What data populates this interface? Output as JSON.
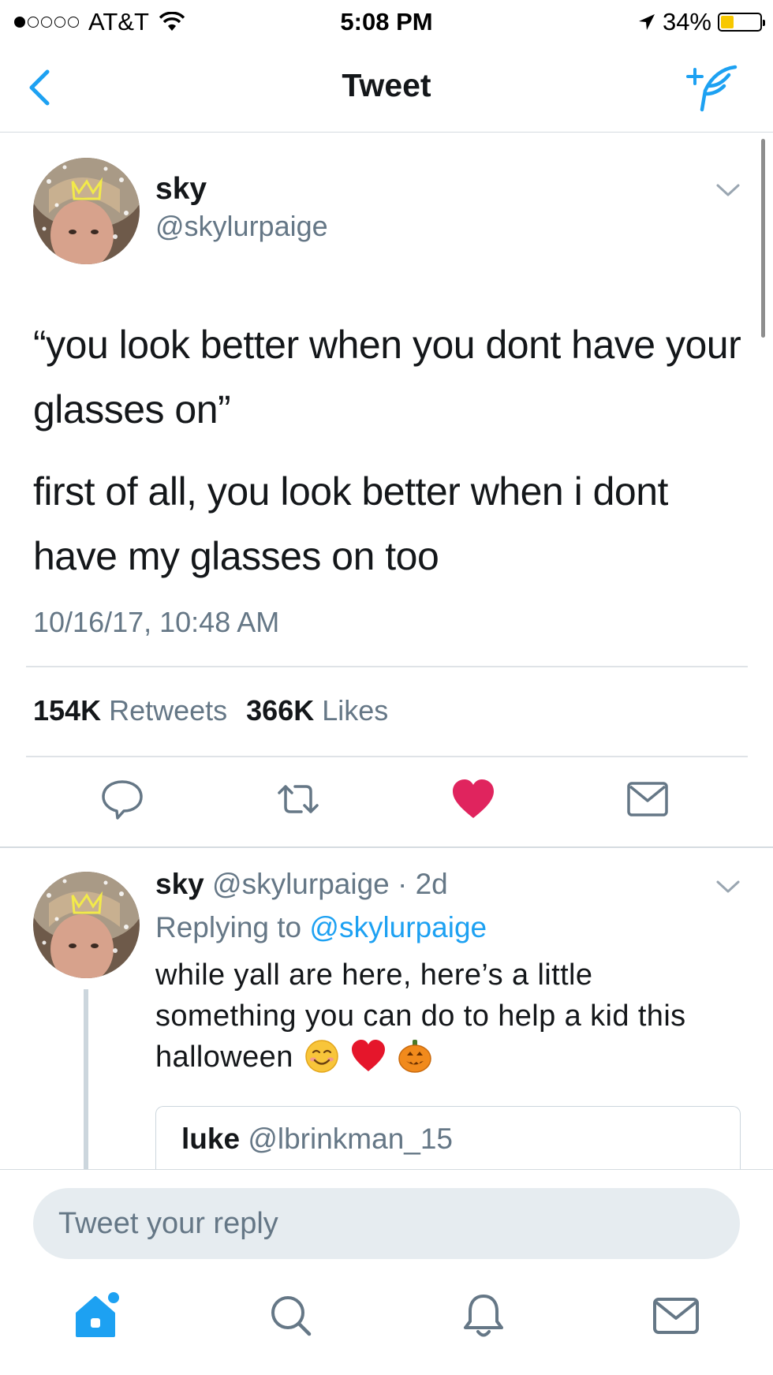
{
  "status_bar": {
    "carrier": "AT&T",
    "time": "5:08 PM",
    "battery": "34%",
    "battery_level": 0.34
  },
  "header": {
    "title": "Tweet",
    "back_icon": "chevron-left-icon",
    "compose_icon": "compose-tweet-icon"
  },
  "tweet": {
    "name": "sky",
    "handle": "@skylurpaige",
    "text_paragraphs": [
      "“you look better when you dont have your glasses on”",
      "first of all, you look better when i dont have my glasses on too"
    ],
    "timestamp": "10/16/17, 10:48 AM",
    "retweets_count": "154K",
    "retweets_label": "Retweets",
    "likes_count": "366K",
    "likes_label": "Likes",
    "liked": true
  },
  "reply": {
    "name": "sky",
    "handle_time": "@skylurpaige · 2d",
    "replying_prefix": "Replying to",
    "replying_to": "@skylurpaige",
    "text": "while yall are here, here’s a little something you can do to help a kid this halloween",
    "emojis": [
      "smiling-face-icon",
      "red-heart-icon",
      "jack-o-lantern-icon"
    ],
    "quote": {
      "name": "luke",
      "handle": "@lbrinkman_15"
    }
  },
  "reply_box": {
    "placeholder": "Tweet your reply"
  },
  "tab_bar": [
    "home-icon",
    "search-icon",
    "notifications-icon",
    "messages-icon"
  ],
  "colors": {
    "accent": "#1da1f2",
    "like": "#e0245e",
    "secondary_text": "#657786"
  }
}
